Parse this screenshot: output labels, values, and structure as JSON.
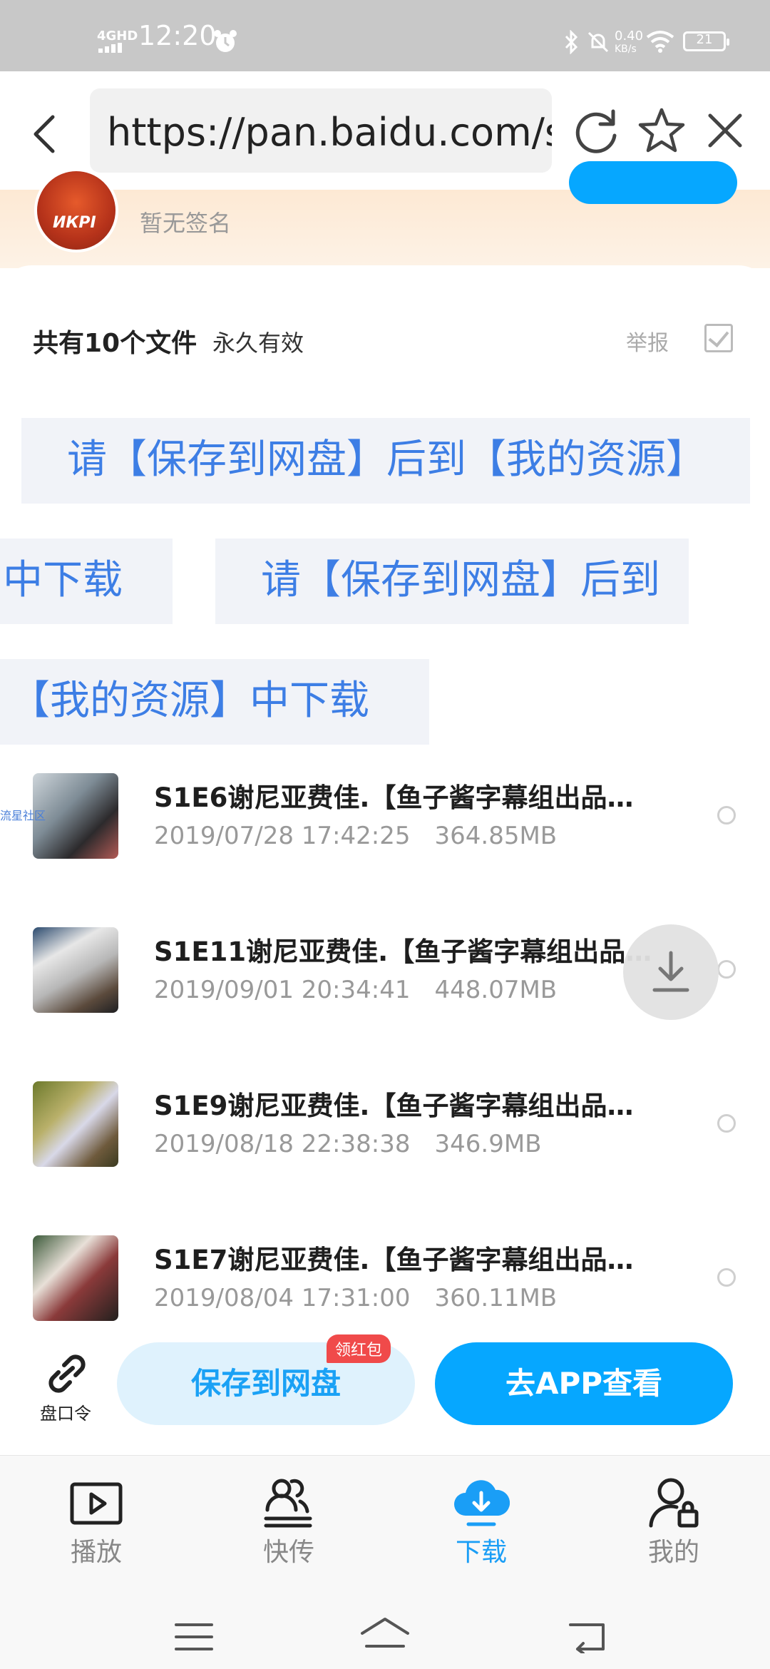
{
  "status_bar": {
    "network": "4GHD",
    "time": "12:20",
    "speed_value": "0.40",
    "speed_unit": "KB/s",
    "battery": "21"
  },
  "browser": {
    "url": "https://pan.baidu.com/s/"
  },
  "profile": {
    "avatar_text": "ИКРІ",
    "signature": "暂无签名"
  },
  "share": {
    "file_count": "共有10个文件",
    "validity": "永久有效",
    "report": "举报"
  },
  "notices": [
    "请【保存到网盘】后到【我的资源】",
    "中下载",
    "请【保存到网盘】后到",
    "【我的资源】中下载"
  ],
  "files": [
    {
      "name": "S1E6谢尼亚费佳.【鱼子酱字幕组出品…",
      "date": "2019/07/28 17:42:25",
      "size": "364.85MB",
      "watermark": "流星社区"
    },
    {
      "name": "S1E11谢尼亚费佳.【鱼子酱字幕组出品…",
      "date": "2019/09/01 20:34:41",
      "size": "448.07MB"
    },
    {
      "name": "S1E9谢尼亚费佳.【鱼子酱字幕组出品…",
      "date": "2019/08/18 22:38:38",
      "size": "346.9MB"
    },
    {
      "name": "S1E7谢尼亚费佳.【鱼子酱字幕组出品…",
      "date": "2019/08/04 17:31:00",
      "size": "360.11MB"
    }
  ],
  "actions": {
    "link_label": "盘口令",
    "save_label": "保存到网盘",
    "badge": "领红包",
    "app_label": "去APP查看"
  },
  "nav": [
    {
      "label": "播放",
      "icon": "play-icon"
    },
    {
      "label": "快传",
      "icon": "transfer-icon"
    },
    {
      "label": "下载",
      "icon": "cloud-download-icon",
      "active": true
    },
    {
      "label": "我的",
      "icon": "profile-icon"
    }
  ],
  "colors": {
    "accent": "#06a7ff",
    "notice_text": "#3d7ee5",
    "badge": "#f04a4a"
  }
}
